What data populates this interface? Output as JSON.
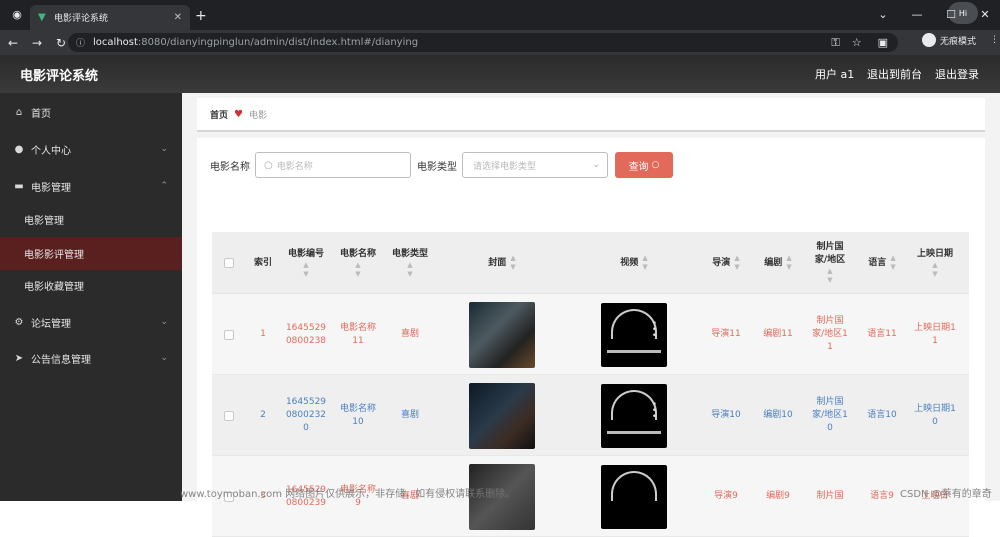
{
  "browser": {
    "tab_title": "电影评论系统",
    "url_host": "localhost",
    "url_path": ":8080/dianyingpinglun/admin/dist/index.html#/dianying",
    "incognito_label": "无痕模式",
    "profile_label": "Hi"
  },
  "header": {
    "title": "电影评论系统",
    "user": "用户 a1",
    "back_to_front": "退出到前台",
    "logout": "退出登录"
  },
  "sidebar": {
    "items": [
      {
        "label": "首页",
        "icon": "home-icon"
      },
      {
        "label": "个人中心",
        "icon": "user-icon"
      },
      {
        "label": "电影管理",
        "icon": "briefcase-icon"
      },
      {
        "label": "论坛管理",
        "icon": "gear-icon"
      },
      {
        "label": "公告信息管理",
        "icon": "send-icon"
      }
    ],
    "sub_items": [
      "电影管理",
      "电影影评管理",
      "电影收藏管理"
    ],
    "active_sub": "电影影评管理"
  },
  "breadcrumb": {
    "home": "首页",
    "current": "电影"
  },
  "filters": {
    "name_label": "电影名称",
    "name_placeholder": "电影名称",
    "type_label": "电影类型",
    "type_placeholder": "请选择电影类型",
    "query_label": "查询"
  },
  "table": {
    "headers": {
      "index": "索引",
      "code": "电影编号",
      "name": "电影名称",
      "type": "电影类型",
      "cover": "封面",
      "video": "视频",
      "director": "导演",
      "writer": "编剧",
      "country_l1": "制片国",
      "country_l2": "家/地区",
      "language": "语言",
      "release": "上映日期"
    },
    "rows": [
      {
        "index": "1",
        "code": "16455290800238",
        "name": "电影名称11",
        "type": "喜剧",
        "director": "导演11",
        "writer": "编剧11",
        "country": "制片国家/地区11",
        "language": "语言11",
        "release": "上映日期11",
        "color": "red"
      },
      {
        "index": "2",
        "code": "16455290800232 0",
        "name": "电影名称10",
        "type": "喜剧",
        "director": "导演10",
        "writer": "编剧10",
        "country": "制片国家/地区10",
        "language": "语言10",
        "release": "上映日期10",
        "color": "blue"
      },
      {
        "index": "3",
        "code": "1645529 0800239",
        "name": "电影名称9",
        "type": "喜剧",
        "director": "导演9",
        "writer": "编剧9",
        "country": "制片国",
        "language": "语言9",
        "release": "上映日",
        "color": "red"
      }
    ]
  },
  "watermark": {
    "left": "www.toymoban.com 网络图片仅供展示，非存储，如有侵权请联系删除。",
    "right": "CSDN @蔡有的章奇"
  }
}
